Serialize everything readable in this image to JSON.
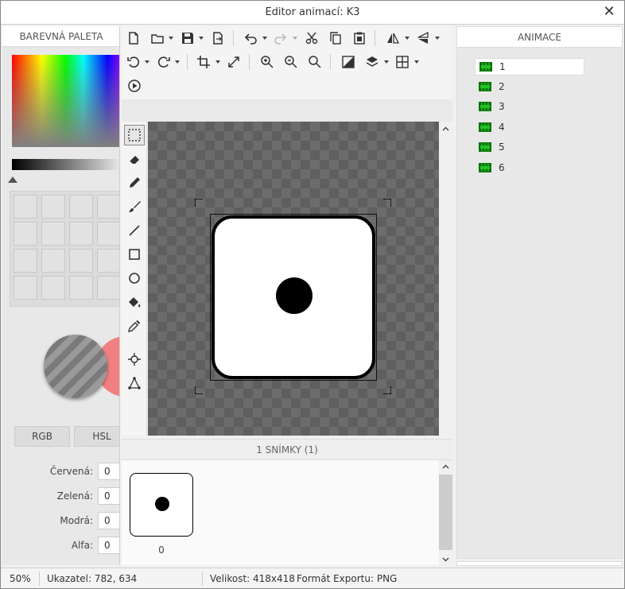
{
  "window": {
    "title": "Editor animací: K3",
    "close_icon": "close-icon"
  },
  "palette": {
    "header": "BAREVNÁ PALETA",
    "modes": [
      "RGB",
      "HSL"
    ],
    "channels": [
      {
        "label": "Červená:",
        "value": "0"
      },
      {
        "label": "Zelená:",
        "value": "0"
      },
      {
        "label": "Modrá:",
        "value": "0"
      },
      {
        "label": "Alfa:",
        "value": "0"
      }
    ],
    "new_color": "#f08080"
  },
  "toolbar": {
    "row1": [
      "new-file-icon",
      "open-folder-icon",
      "save-icon",
      "export-icon",
      "undo-icon",
      "redo-icon",
      "cut-icon",
      "copy-icon",
      "paste-icon",
      "flip-horizontal-icon",
      "flip-vertical-icon"
    ],
    "row2": [
      "rotate-left-icon",
      "rotate-right-icon",
      "crop-icon",
      "resize-icon",
      "zoom-in-icon",
      "zoom-out-icon",
      "zoom-reset-icon",
      "invert-icon",
      "layers-icon",
      "grid-icon"
    ],
    "row3": [
      "play-icon"
    ]
  },
  "tools": [
    "select-rect-icon",
    "eraser-icon",
    "pencil-icon",
    "brush-icon",
    "line-icon",
    "rectangle-icon",
    "ellipse-icon",
    "fill-bucket-icon",
    "eyedropper-icon",
    "crosshair-icon",
    "polygon-icon"
  ],
  "frames": {
    "header": "1 SNÍMKY (1)",
    "items": [
      {
        "label": "0"
      }
    ]
  },
  "animations": {
    "header": "ANIMACE",
    "items": [
      {
        "label": "1",
        "selected": true
      },
      {
        "label": "2"
      },
      {
        "label": "3"
      },
      {
        "label": "4"
      },
      {
        "label": "5"
      },
      {
        "label": "6"
      }
    ]
  },
  "status": {
    "zoom": "50%",
    "pointer": "Ukazatel: 782, 634",
    "size": "Velikost: 418x418",
    "format": "Formát Exportu: PNG"
  }
}
